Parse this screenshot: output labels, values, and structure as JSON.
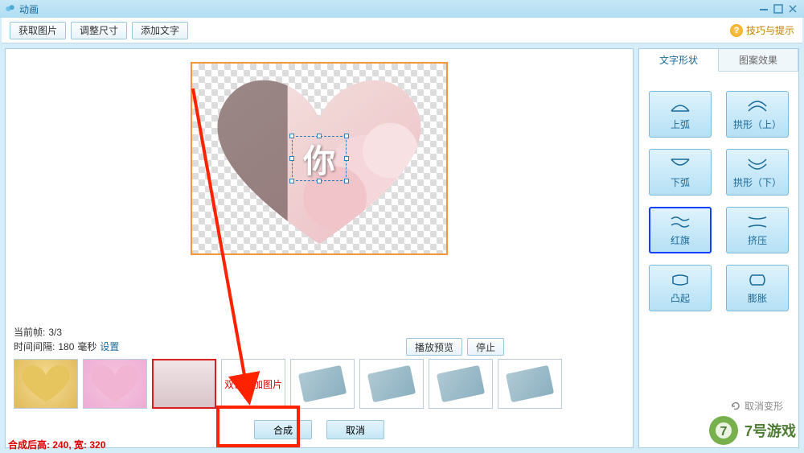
{
  "window": {
    "title": "动画"
  },
  "toolbar": {
    "get_image": "获取图片",
    "resize": "调整尺寸",
    "add_text": "添加文字",
    "tips": "技巧与提示"
  },
  "canvas": {
    "overlay_text": "你"
  },
  "frame_info": {
    "current_label": "当前帧:",
    "current_value": "3/3",
    "interval_label": "时间间隔:",
    "interval_value": "180",
    "interval_unit": "毫秒",
    "settings_link": "设置"
  },
  "preview": {
    "play_preview": "播放预览",
    "stop": "停止"
  },
  "timeline": {
    "add_hint": "双击添加图片"
  },
  "actions": {
    "compose": "合成",
    "cancel": "取消"
  },
  "status": {
    "text": "合成后高: 240, 宽: 320"
  },
  "tabs": {
    "text_shape": "文字形状",
    "pattern_effect": "图案效果"
  },
  "shapes": {
    "up_arc": "上弧",
    "arch_up": "拱形（上）",
    "down_arc": "下弧",
    "arch_down": "拱形（下）",
    "flag": "红旗",
    "squeeze": "挤压",
    "bulge": "凸起",
    "expand": "膨胀"
  },
  "misc": {
    "cancel_transform": "取消变形"
  },
  "watermark": {
    "brand": "7号游戏"
  }
}
